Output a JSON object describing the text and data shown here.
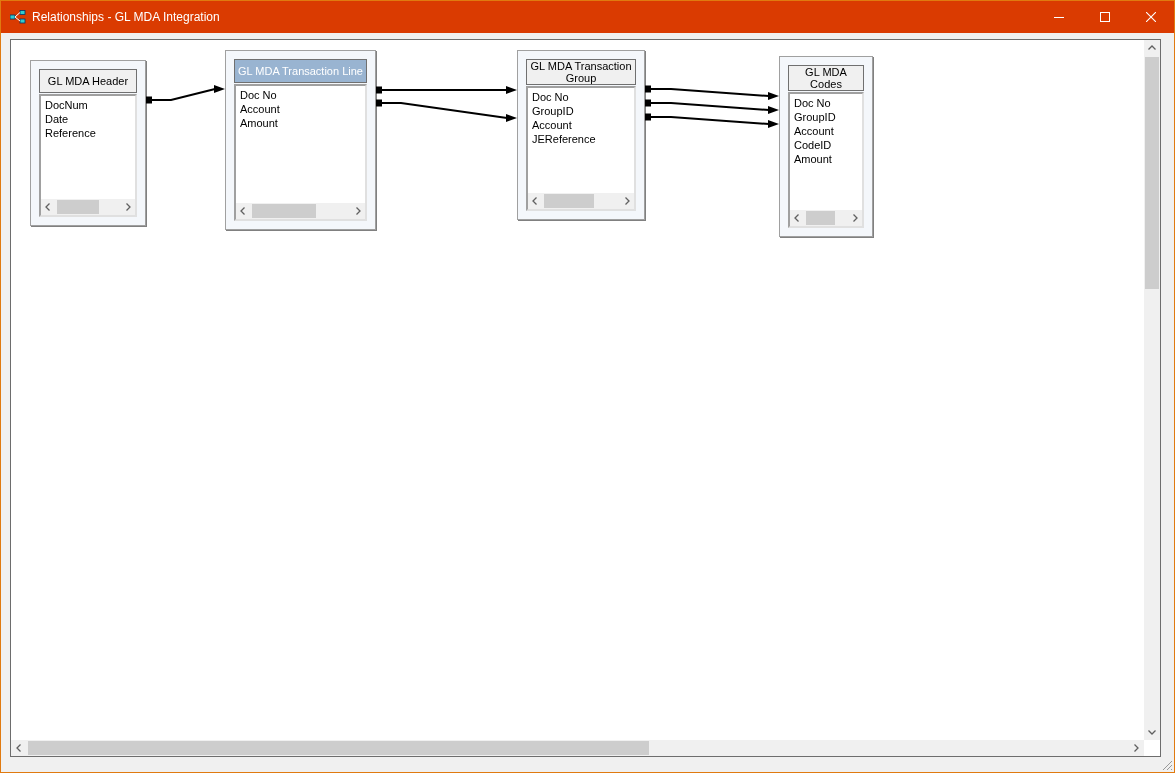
{
  "window": {
    "title": "Relationships - GL MDA Integration"
  },
  "tables": [
    {
      "title": "GL MDA Header",
      "selected": false,
      "fields": [
        "DocNum",
        "Date",
        "Reference"
      ]
    },
    {
      "title": "GL MDA Transaction Line",
      "selected": true,
      "fields": [
        "Doc No",
        "Account",
        "Amount"
      ]
    },
    {
      "title": "GL MDA Transaction Group",
      "selected": false,
      "fields": [
        "Doc No",
        "GroupID",
        "Account",
        "JEReference"
      ]
    },
    {
      "title": "GL MDA Codes",
      "selected": false,
      "fields": [
        "Doc No",
        "GroupID",
        "Account",
        "CodeID",
        "Amount"
      ]
    }
  ]
}
